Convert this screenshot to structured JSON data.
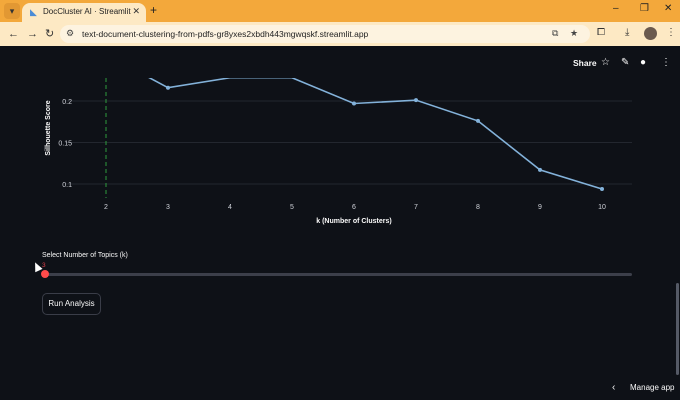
{
  "browser": {
    "tab_title": "DocCluster AI · Streamlit",
    "url": "text-document-clustering-from-pdfs-gr8yxes2xbdh443mgwqskf.streamlit.app",
    "icons": {
      "tab_list": "chevron-down-icon",
      "new_tab": "plus-icon",
      "back": "arrow-left-icon",
      "forward": "arrow-right-icon",
      "reload": "reload-icon",
      "site_info": "site-info-icon",
      "install": "install-app-icon",
      "bookmark": "star-icon",
      "extensions": "puzzle-icon",
      "download": "download-icon",
      "menu": "more-vertical-icon"
    }
  },
  "app": {
    "toolbar": {
      "share_label": "Share"
    },
    "slider": {
      "label": "Select Number of Topics (k)",
      "value": "3",
      "fraction": 0
    },
    "run_button_label": "Run Analysis",
    "manage_app_label": "Manage app",
    "colors": {
      "background": "#0e1117",
      "line": "#83b2da",
      "threshold": "#2e9b3c",
      "slider_thumb": "#ff4b4b"
    }
  },
  "chart_data": {
    "type": "line",
    "xlabel": "k (Number of Clusters)",
    "ylabel": "Silhouette Score",
    "x": [
      2,
      3,
      4,
      5,
      6,
      7,
      8,
      9,
      10
    ],
    "y_visible_ticks": [
      "0.1",
      "0.15",
      "0.2"
    ],
    "series": [
      {
        "values": [
          null,
          0.216,
          0.228,
          0.228,
          0.197,
          0.201,
          0.176,
          0.117,
          0.094
        ]
      }
    ],
    "vline_x": 2,
    "grid": "horizontal",
    "x_tick_labels": [
      "2",
      "3",
      "4",
      "5",
      "6",
      "7",
      "8",
      "9",
      "10"
    ]
  }
}
